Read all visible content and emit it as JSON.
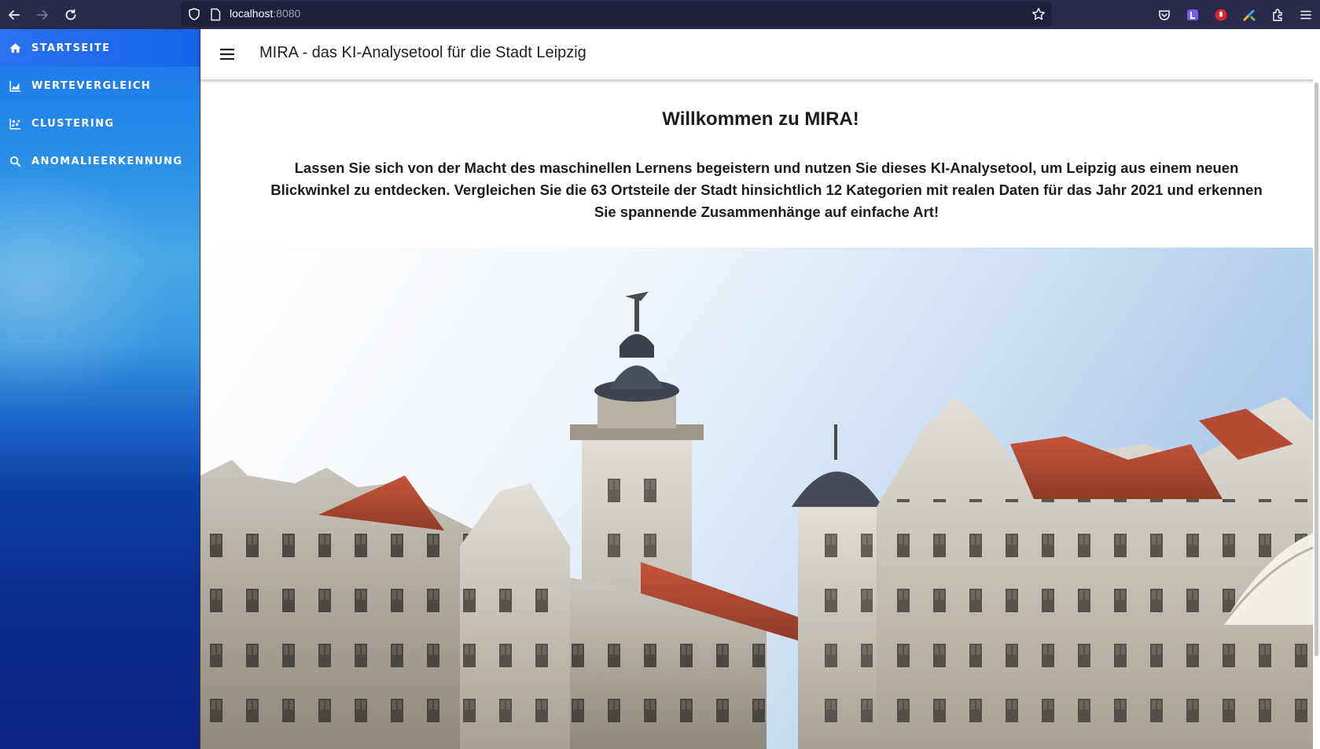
{
  "browser": {
    "url_host": "localhost",
    "url_port": ":8080",
    "icons": [
      "back-arrow-icon",
      "forward-arrow-icon",
      "reload-icon",
      "shield-icon",
      "page-icon",
      "bookmark-star-icon",
      "pocket-icon",
      "extension-l-icon",
      "block-hand-icon",
      "extension-brush-icon",
      "extensions-puzzle-icon",
      "hamburger-menu-icon"
    ]
  },
  "sidebar": {
    "items": [
      {
        "label": "STARTSEITE",
        "icon": "home-icon",
        "active": true
      },
      {
        "label": "WERTEVERGLEICH",
        "icon": "area-chart-icon",
        "active": false
      },
      {
        "label": "CLUSTERING",
        "icon": "scatter-chart-icon",
        "active": false
      },
      {
        "label": "ANOMALIEERKENNUNG",
        "icon": "search-icon",
        "active": false
      }
    ]
  },
  "app_bar": {
    "title": "MIRA - das KI-Analysetool für die Stadt Leipzig"
  },
  "main": {
    "heading": "Willkommen zu MIRA!",
    "intro": "Lassen Sie sich von der Macht des maschinellen Lernens begeistern und nutzen Sie dieses KI-Analysetool, um Leipzig aus einem neuen Blickwinkel zu entdecken. Vergleichen Sie die 63 Ortsteile der Stadt hinsichtlich 12 Kategorien mit realen Daten für das Jahr 2021 und erkennen Sie spannende Zusammenhänge auf einfache Art!"
  },
  "colors": {
    "browser_bar": "#2b2a4c",
    "sidebar_top": "#1b74ec",
    "sidebar_bottom": "#0c2483",
    "active_item": "#1664e8"
  }
}
